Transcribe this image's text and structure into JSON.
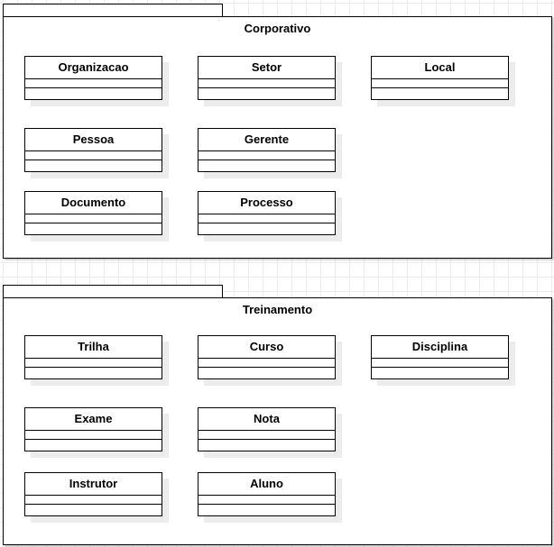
{
  "packages": [
    {
      "name": "Corporativo",
      "classes": [
        {
          "name": "Organizacao"
        },
        {
          "name": "Setor"
        },
        {
          "name": "Local"
        },
        {
          "name": "Pessoa"
        },
        {
          "name": "Gerente"
        },
        {
          "name": "Documento"
        },
        {
          "name": "Processo"
        }
      ]
    },
    {
      "name": "Treinamento",
      "classes": [
        {
          "name": "Trilha"
        },
        {
          "name": "Curso"
        },
        {
          "name": "Disciplina"
        },
        {
          "name": "Exame"
        },
        {
          "name": "Nota"
        },
        {
          "name": "Instrutor"
        },
        {
          "name": "Aluno"
        }
      ]
    }
  ]
}
